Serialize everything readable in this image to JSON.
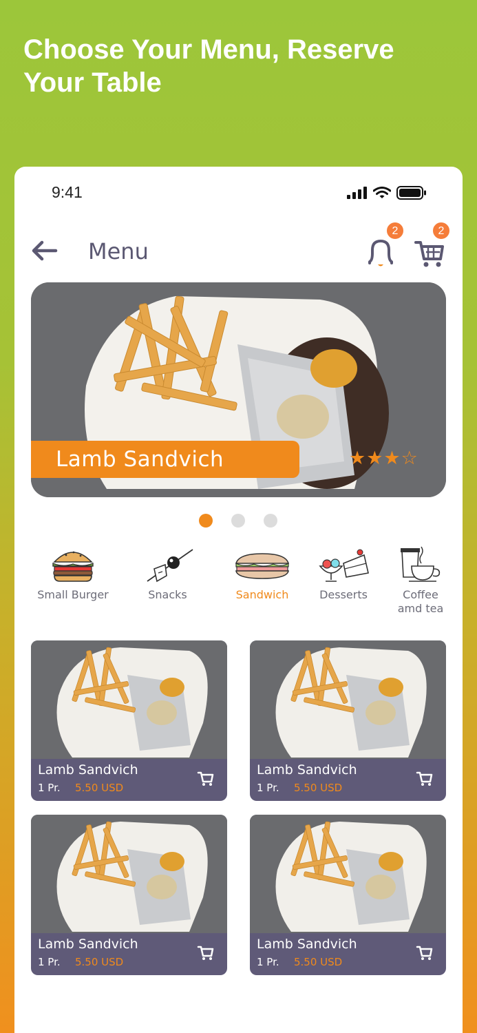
{
  "headline": "Choose Your Menu, Reserve Your Table",
  "status_bar": {
    "time": "9:41"
  },
  "nav": {
    "title": "Menu",
    "notification_count": "2",
    "cart_count": "2"
  },
  "hero": {
    "title": "Lamb Sandvich",
    "rating": 3,
    "rating_max": 5,
    "stars": "★★★☆",
    "carousel_pages": 3,
    "carousel_active": 0
  },
  "categories": [
    {
      "label": "Small Burger",
      "icon": "burger-icon",
      "active": false
    },
    {
      "label": "Snacks",
      "icon": "snack-skewer-icon",
      "active": false
    },
    {
      "label": "Sandwich",
      "icon": "sandwich-icon",
      "active": true
    },
    {
      "label": "Desserts",
      "icon": "dessert-icon",
      "active": false
    },
    {
      "label": "Coffee amd tea",
      "label_line1": "Coffee",
      "label_line2": "amd tea",
      "icon": "coffee-cup-icon",
      "active": false
    }
  ],
  "products": [
    {
      "name": "Lamb Sandvich",
      "qty": "1 Pr.",
      "price": "5.50 USD"
    },
    {
      "name": "Lamb Sandvich",
      "qty": "1 Pr.",
      "price": "5.50 USD"
    },
    {
      "name": "Lamb Sandvich",
      "qty": "1 Pr.",
      "price": "5.50 USD"
    },
    {
      "name": "Lamb Sandvich",
      "qty": "1 Pr.",
      "price": "5.50 USD"
    }
  ],
  "colors": {
    "accent": "#f08a1c",
    "badge": "#f57d3a",
    "card_bar": "#5f5a78",
    "nav_text": "#5b5872",
    "background_top": "#9cc63a",
    "background_bottom": "#f0901e"
  }
}
